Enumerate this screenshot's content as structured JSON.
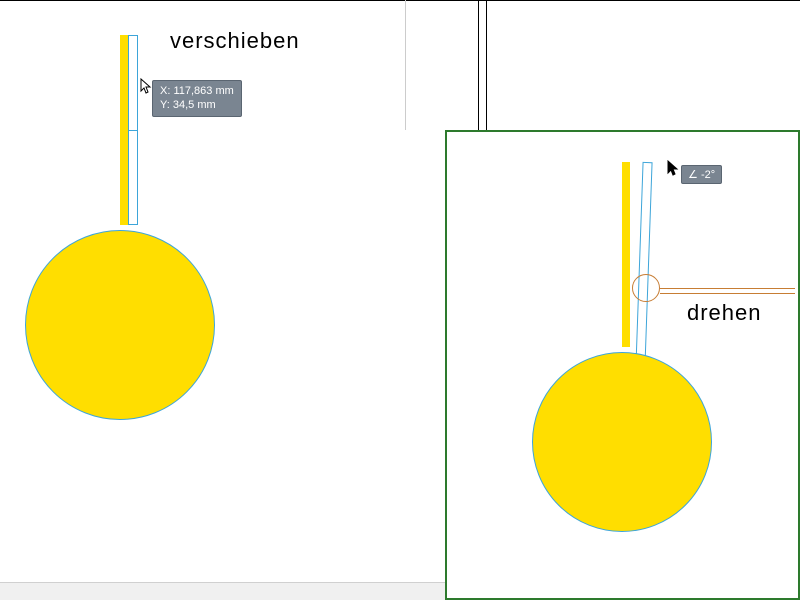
{
  "labels": {
    "move": "verschieben",
    "rotate": "drehen"
  },
  "tooltip_move": {
    "x_label": "X:",
    "x_value": "117,863 mm",
    "y_label": "Y:",
    "y_value": "34,5 mm"
  },
  "tooltip_rotate": {
    "angle_symbol": "∠",
    "angle_value": "-2°"
  },
  "colors": {
    "shape_fill": "#ffde00",
    "shape_stroke": "#3da5d9",
    "inset_border": "#2d7a2d",
    "rotation_guide": "#c77d34",
    "tooltip_bg": "#7a8591"
  }
}
